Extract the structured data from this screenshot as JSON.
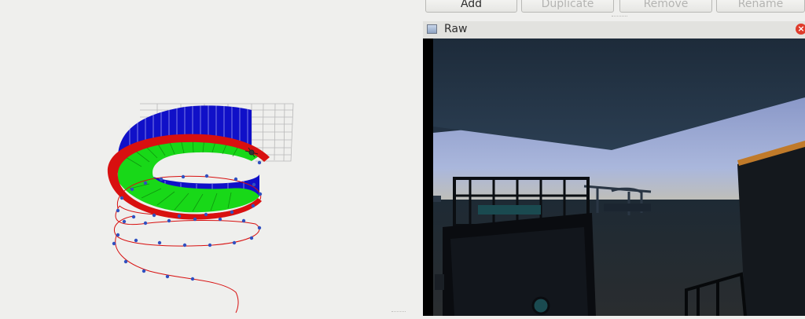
{
  "toolbar": {
    "add_label": "Add",
    "duplicate_label": "Duplicate",
    "remove_label": "Remove",
    "rename_label": "Rename"
  },
  "image_panel": {
    "title": "Raw",
    "icon": "image-icon",
    "close_icon": "close-icon"
  },
  "viewport": {
    "content": "3D trajectory visualization",
    "colors": {
      "blue": "#1010c8",
      "green": "#18d818",
      "red": "#d81010",
      "waypoint": "#3050c0"
    }
  }
}
